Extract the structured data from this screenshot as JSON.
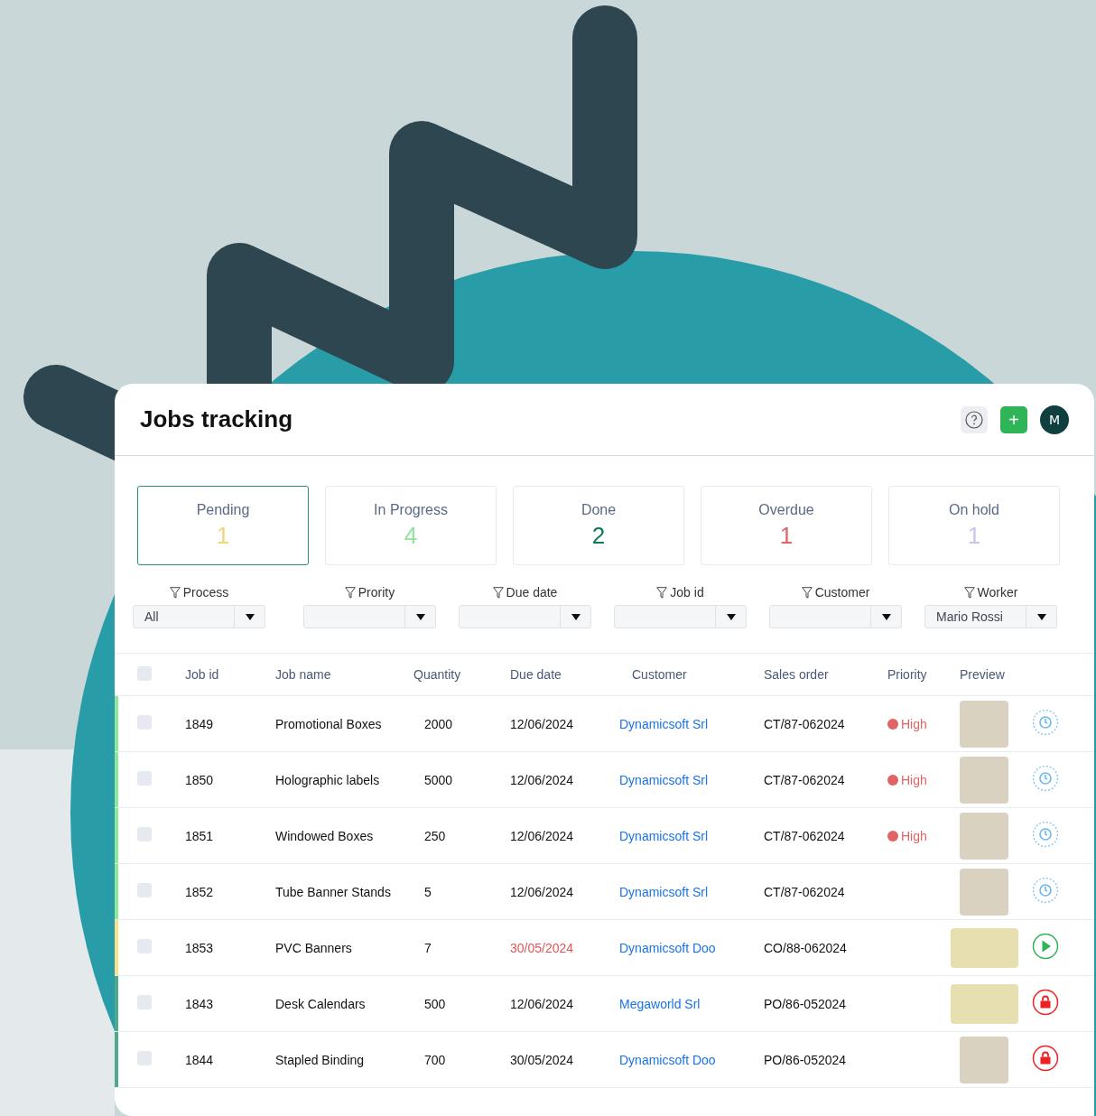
{
  "header": {
    "title": "Jobs tracking",
    "avatar": "M",
    "add_icon": "+"
  },
  "stats": [
    {
      "label": "Pending",
      "value": "1",
      "color": "#f3d27a",
      "selected": true
    },
    {
      "label": "In Progress",
      "value": "4",
      "color": "#8fe39c",
      "selected": false
    },
    {
      "label": "Done",
      "value": "2",
      "color": "#0f7a58",
      "selected": false
    },
    {
      "label": "Overdue",
      "value": "1",
      "color": "#e06464",
      "selected": false
    },
    {
      "label": "On hold",
      "value": "1",
      "color": "#c9c2f5",
      "selected": false
    }
  ],
  "filters": [
    {
      "label": "Process",
      "value": "All"
    },
    {
      "label": "Prority"
    },
    {
      "label": "Due date"
    },
    {
      "label": "Job id"
    },
    {
      "label": "Customer"
    },
    {
      "label": "Worker",
      "value": "Mario Rossi"
    }
  ],
  "table": {
    "header_checked": false,
    "columns": [
      "Job id",
      "Job name",
      "Quantity",
      "Due date",
      "Customer",
      "Sales order",
      "Priority",
      "Preview"
    ],
    "rows": [
      {
        "color": "#8ee89a",
        "checked": false,
        "job_id": "1849",
        "job_name": "Promotional Boxes",
        "quantity": "2000",
        "due_date": "12/06/2024",
        "overdue": false,
        "customer": "Dynamicsoft Srl",
        "sales_order": "CT/87-062024",
        "priority": "High",
        "preview_wide": false,
        "kind": "timer"
      },
      {
        "color": "#8ee89a",
        "checked": false,
        "job_id": "1850",
        "job_name": "Holographic labels",
        "quantity": "5000",
        "due_date": "12/06/2024",
        "overdue": false,
        "customer": "Dynamicsoft Srl",
        "sales_order": "CT/87-062024",
        "priority": "High",
        "preview_wide": false,
        "kind": "timer"
      },
      {
        "color": "#8ee89a",
        "checked": false,
        "job_id": "1851",
        "job_name": "Windowed Boxes",
        "quantity": "250",
        "due_date": "12/06/2024",
        "overdue": false,
        "customer": "Dynamicsoft Srl",
        "sales_order": "CT/87-062024",
        "priority": "High",
        "preview_wide": false,
        "kind": "timer"
      },
      {
        "color": "#8ee89a",
        "checked": false,
        "job_id": "1852",
        "job_name": "Tube Banner Stands",
        "quantity": "5",
        "due_date": "12/06/2024",
        "overdue": false,
        "customer": "Dynamicsoft Srl",
        "sales_order": "CT/87-062024",
        "preview_wide": false,
        "kind": "timer"
      },
      {
        "color": "#fbe08a",
        "checked": false,
        "job_id": "1853",
        "job_name": "PVC Banners",
        "quantity": "7",
        "due_date": "30/05/2024",
        "overdue": true,
        "customer": "Dynamicsoft Doo",
        "sales_order": "CO/88-062024",
        "preview_wide": true,
        "kind": "play"
      },
      {
        "color": "#4fa98f",
        "checked": false,
        "job_id": "1843",
        "job_name": "Desk Calendars",
        "quantity": "500",
        "due_date": "12/06/2024",
        "overdue": false,
        "customer": "Megaworld Srl",
        "sales_order": "PO/86-052024",
        "preview_wide": true,
        "kind": "locked"
      },
      {
        "color": "#4fa98f",
        "checked": false,
        "job_id": "1844",
        "job_name": "Stapled Binding",
        "quantity": "700",
        "due_date": "30/05/2024",
        "overdue": false,
        "customer": "Dynamicsoft Doo",
        "sales_order": "PO/86-052024",
        "preview_wide": false,
        "kind": "locked"
      }
    ]
  }
}
